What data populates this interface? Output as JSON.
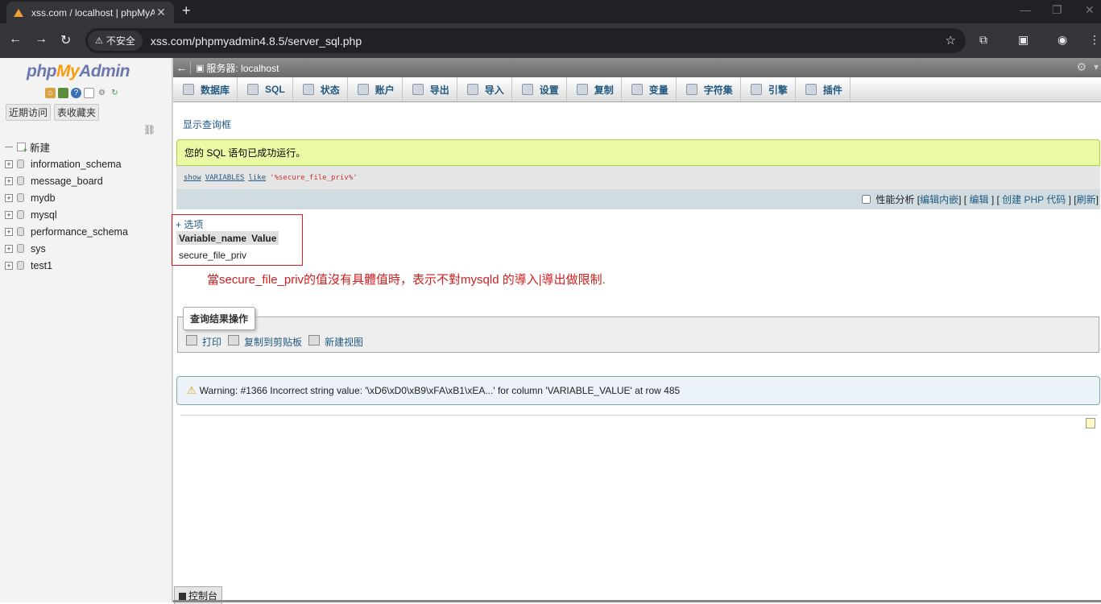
{
  "browser": {
    "tab_title": "xss.com / localhost | phpMyA",
    "close": "✕",
    "new_tab": "+",
    "security_label": "不安全",
    "url": "xss.com/phpmyadmin4.8.5/server_sql.php"
  },
  "logo": {
    "php": "php",
    "my": "My",
    "admin": "Admin"
  },
  "nav": {
    "tabs": [
      "近期访问",
      "表收藏夹"
    ],
    "new_label": "新建",
    "databases": [
      "information_schema",
      "message_board",
      "mydb",
      "mysql",
      "performance_schema",
      "sys",
      "test1"
    ]
  },
  "server": {
    "title": "服务器: localhost"
  },
  "menu": [
    "数据库",
    "SQL",
    "状态",
    "账户",
    "导出",
    "导入",
    "设置",
    "复制",
    "变量",
    "字符集",
    "引擎",
    "插件"
  ],
  "show_query": "显示查询框",
  "success_message": "您的 SQL 语句已成功运行。",
  "sql": {
    "show": "show",
    "variables": "VARIABLES",
    "like": "like",
    "pattern": "'%secure_file_priv%'"
  },
  "tools": {
    "profiling": "性能分析",
    "edit_inline": "编辑内嵌",
    "edit": "编辑",
    "create_php": "创建 PHP 代码",
    "refresh": "刷新"
  },
  "results": {
    "options": "+ 选项",
    "headers": [
      "Variable_name",
      "Value"
    ],
    "rows": [
      [
        "secure_file_priv",
        ""
      ]
    ]
  },
  "annotation": "當secure_file_priv的值沒有具體值時，表示不對mysqld 的導入|導出做限制.",
  "query_ops": {
    "legend": "查询结果操作",
    "print": "打印",
    "copy": "复制到剪贴板",
    "new_view": "新建视图"
  },
  "warning": "Warning: #1366 Incorrect string value: '\\xD6\\xD0\\xB9\\xFA\\xB1\\xEA...' for column 'VARIABLE_VALUE' at row 485",
  "console": "控制台"
}
